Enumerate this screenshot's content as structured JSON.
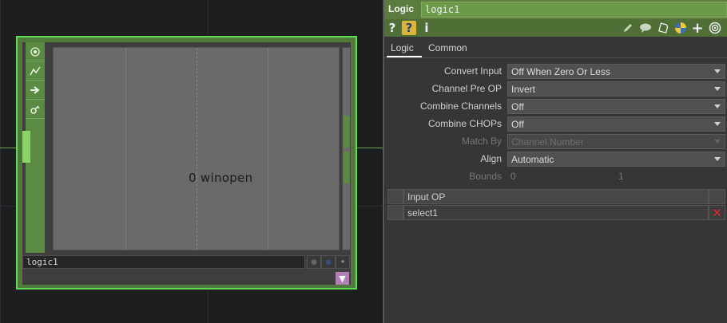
{
  "network": {
    "node": {
      "name": "logic1",
      "view_label": "0 winopen",
      "toolbar_icons": [
        "viewer-icon",
        "graph-icon",
        "arrow-right-icon",
        "key-icon"
      ]
    }
  },
  "params": {
    "op_type": "Logic",
    "op_name": "logic1",
    "tabs": [
      {
        "label": "Logic",
        "active": true
      },
      {
        "label": "Common",
        "active": false
      }
    ],
    "rows": [
      {
        "label": "Convert Input",
        "value": "Off When Zero Or Less",
        "enabled": true
      },
      {
        "label": "Channel Pre OP",
        "value": "Invert",
        "enabled": true
      },
      {
        "label": "Combine Channels",
        "value": "Off",
        "enabled": true
      },
      {
        "label": "Combine CHOPs",
        "value": "Off",
        "enabled": true
      },
      {
        "label": "Match By",
        "value": "Channel Number",
        "enabled": false
      },
      {
        "label": "Align",
        "value": "Automatic",
        "enabled": true
      }
    ],
    "bounds": {
      "label": "Bounds",
      "values": [
        "0",
        "1"
      ]
    },
    "sequence": {
      "header": "Input OP",
      "rows": [
        "select1"
      ]
    }
  },
  "colors": {
    "node_border": "#5fd95a",
    "header_green": "#5b7b3f",
    "delete_red": "#e02b2b"
  }
}
